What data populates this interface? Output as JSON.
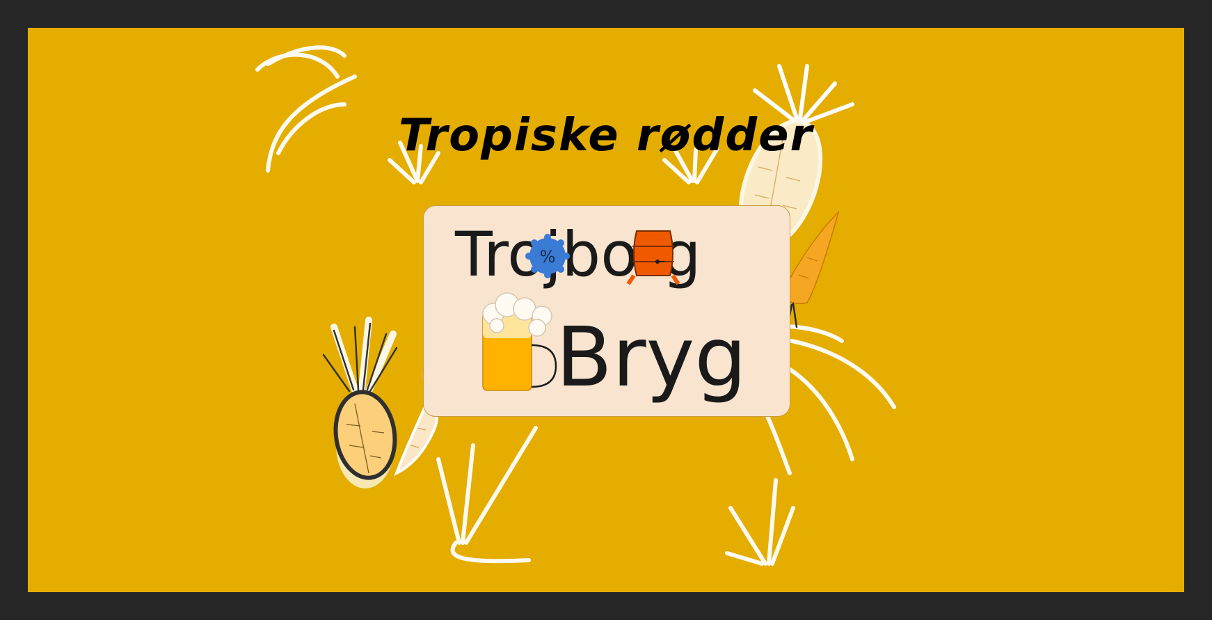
{
  "label": {
    "title": "Tropiske rødder",
    "background_color": "#e5ad00",
    "frame_color": "#262626"
  },
  "logo": {
    "line1": "Trojborg",
    "line2": "Bryg",
    "card_color": "#f8e4cf",
    "icons": [
      "bottle-cap-percent-icon",
      "barrel-icon",
      "beer-mug-icon"
    ],
    "cap_color": "#3a7bd5",
    "barrel_color": "#ef5a00",
    "beer_color": "#ffb300"
  },
  "illustrations": [
    "pineapple-icon",
    "carrot-icon",
    "leaf-sprout-icon"
  ]
}
